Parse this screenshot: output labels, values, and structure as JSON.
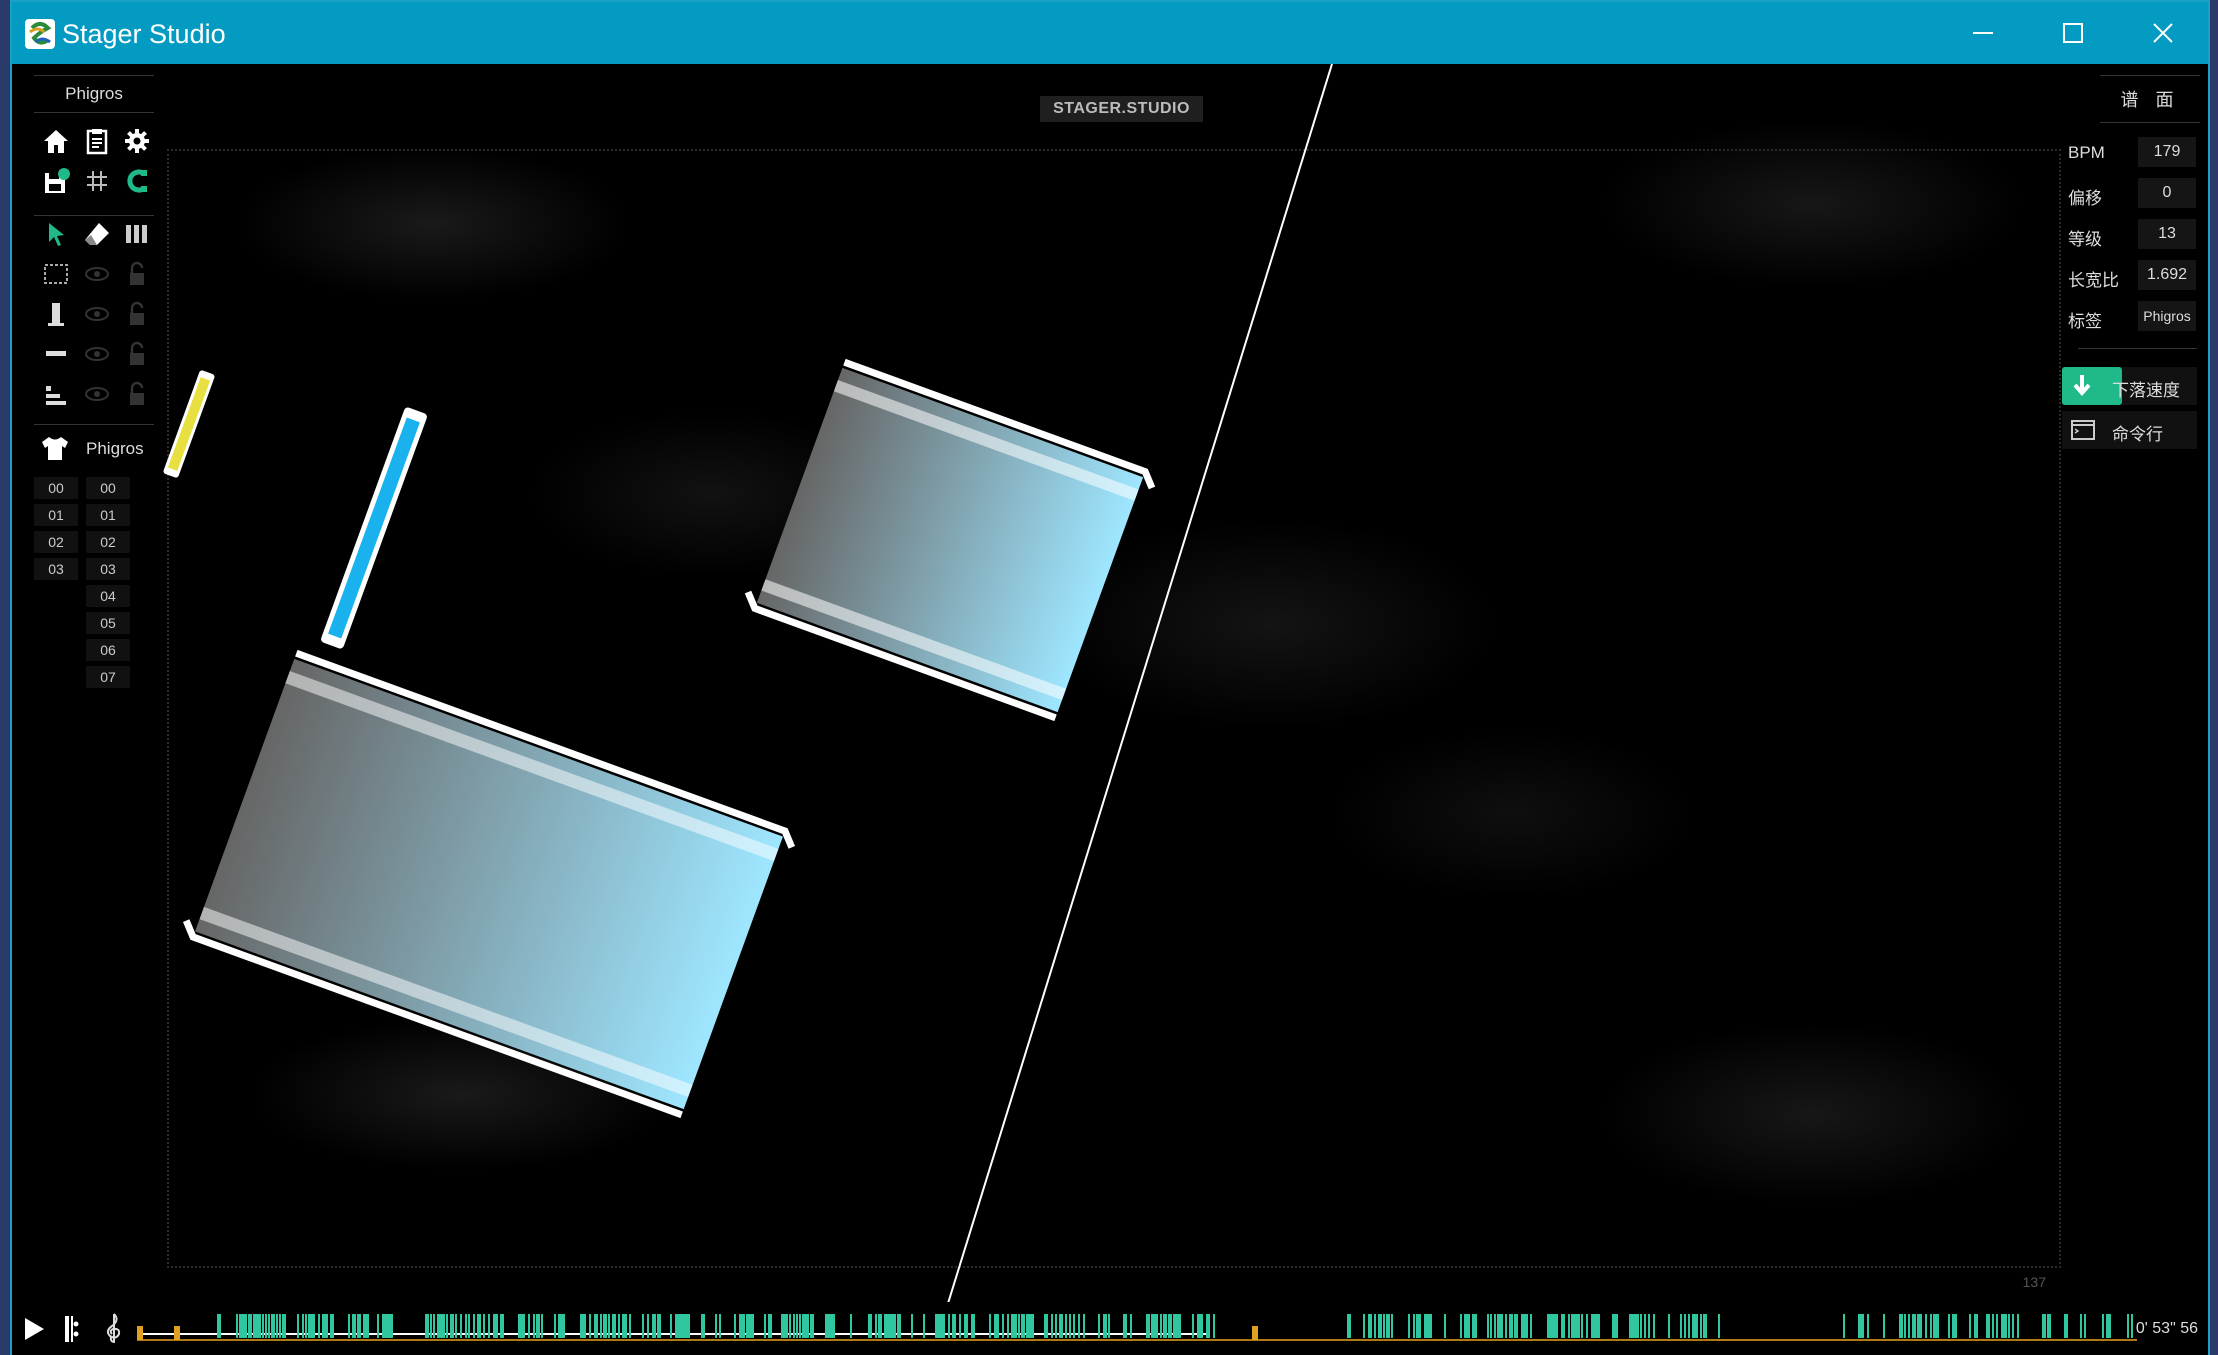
{
  "window": {
    "title": "Stager Studio"
  },
  "titlebar": {
    "minimize_icon": "minimize-icon",
    "maximize_icon": "maximize-icon",
    "close_icon": "close-icon"
  },
  "stage": {
    "watermark": "STAGER.STUDIO",
    "corner_number": "137"
  },
  "left_panel": {
    "header": "Phigros",
    "tools_row1": [
      "home-icon",
      "clipboard-icon",
      "gear-icon"
    ],
    "tools_row2": [
      "save-icon",
      "grid-icon",
      "magnet-icon"
    ],
    "tools_row3": [
      "cursor-icon",
      "eraser-icon",
      "columns-icon"
    ],
    "layer_rows": [
      "stage-layer",
      "track-layer",
      "note-layer",
      "timing-layer"
    ],
    "skin_label": "Phigros",
    "line_col1": [
      "00",
      "01",
      "02",
      "03"
    ],
    "line_col2": [
      "00",
      "01",
      "02",
      "03",
      "04",
      "05",
      "06",
      "07"
    ]
  },
  "right_panel": {
    "header": "谱 面",
    "props": [
      {
        "label": "BPM",
        "value": "179"
      },
      {
        "label": "偏移",
        "value": "0"
      },
      {
        "label": "等级",
        "value": "13"
      },
      {
        "label": "长宽比",
        "value": "1.692"
      },
      {
        "label": "标签",
        "value": "Phigros"
      }
    ],
    "fall_speed_label": "下落速度",
    "command_line_label": "命令行",
    "accent": "#1fb98a"
  },
  "bottom_bar": {
    "time": "0' 53\" 56",
    "timeline_color": "#2fc6a0",
    "marker_color": "#e0a020"
  }
}
